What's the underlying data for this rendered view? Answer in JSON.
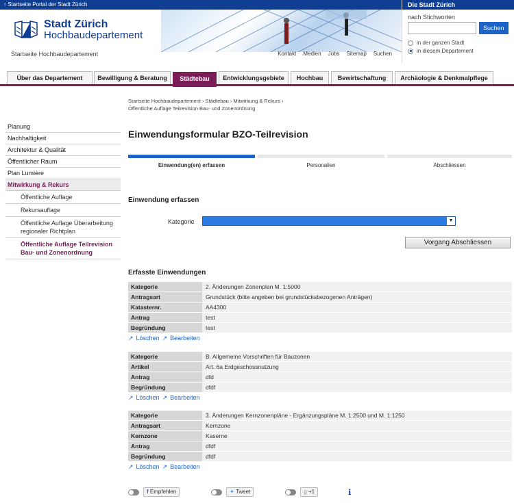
{
  "topbar": {
    "portal_link": "↑ Startseite Portal der Stadt Zürich"
  },
  "logo": {
    "line1": "Stadt Zürich",
    "line2": "Hochbaudepartement"
  },
  "header": {
    "subtitle": "Startseite Hochbaudepartement",
    "links": [
      "Kontakt",
      "Medien",
      "Jobs",
      "Sitemap",
      "Suchen"
    ]
  },
  "search": {
    "head": "Die Stadt Zürich",
    "label": "nach Stichworten",
    "button": "Suchen",
    "value": "",
    "options": [
      "in der ganzen Stadt",
      "in diesem Departement"
    ],
    "selected": "in diesem Departement"
  },
  "nav": {
    "tabs": [
      "Über das Departement",
      "Bewilligung & Beratung",
      "Städtebau",
      "Entwicklungsgebiete",
      "Hochbau",
      "Bewirtschaftung",
      "Archäologie & Denkmalpflege"
    ],
    "active": "Städtebau"
  },
  "breadcrumb": {
    "line1": "Startseite Hochbaudepartement  ›  Städtebau  ›  Mitwirkung & Rekurs  ›",
    "line2": "Öffentliche Auflage Teilrevision Bau- und Zonenordnung"
  },
  "sidebar": {
    "items": [
      "Planung",
      "Nachhaltigkeit",
      "Architektur & Qualität",
      "Öffentlicher Raum",
      "Plan Lumière",
      "Mitwirkung & Rekurs"
    ],
    "subitems": [
      "Öffentliche Auflage",
      "Rekursauflage",
      "Öffentliche Auflage Überarbeitung regionaler Richtplan",
      "Öffentliche Auflage Teilrevision Bau- und Zonenordnung"
    ]
  },
  "main": {
    "title": "Einwendungsformular BZO-Teilrevision",
    "steps": [
      "Einwendung(en) erfassen",
      "Personalien",
      "Abschliessen"
    ],
    "active_step": 1,
    "section1": "Einwendung erfassen",
    "kategorie_label": "Kategorie",
    "kategorie_value": "",
    "done_button": "Vorgang Abschliessen",
    "section2": "Erfasste Einwendungen",
    "delete_label": "Löschen",
    "edit_label": "Bearbeiten"
  },
  "entries": [
    {
      "rows": [
        {
          "k": "Kategorie",
          "v": "2. Änderungen Zonenplan M. 1:5000"
        },
        {
          "k": "Antragsart",
          "v": "Grundstück (bitte angeben bei grundstücksbezogenen Anträgen)"
        },
        {
          "k": "Katasternr.",
          "v": "AA4300"
        },
        {
          "k": "Antrag",
          "v": "test"
        },
        {
          "k": "Begründung",
          "v": "test"
        }
      ]
    },
    {
      "rows": [
        {
          "k": "Kategorie",
          "v": "B. Allgemeine Vorschriften für Bauzonen"
        },
        {
          "k": "Artikel",
          "v": "Art. 6a Erdgeschossnutzung"
        },
        {
          "k": "Antrag",
          "v": "dfd"
        },
        {
          "k": "Begründung",
          "v": "dfdf"
        }
      ]
    },
    {
      "rows": [
        {
          "k": "Kategorie",
          "v": "3. Änderungen Kernzonenpläne - Ergänzungspläne M. 1:2500 und M. 1:1250"
        },
        {
          "k": "Antragsart",
          "v": "Kernzone"
        },
        {
          "k": "Kernzone",
          "v": "Kaserne"
        },
        {
          "k": "Antrag",
          "v": "dfdf"
        },
        {
          "k": "Begründung",
          "v": "dfdf"
        }
      ]
    }
  ],
  "social": {
    "recommend": "Empfehlen",
    "tweet": "Tweet",
    "plus": "+1",
    "info": "i"
  },
  "colors": {
    "brand_blue": "#0f3d91",
    "accent_purple": "#7b1d57",
    "link_blue": "#1e64c8"
  }
}
